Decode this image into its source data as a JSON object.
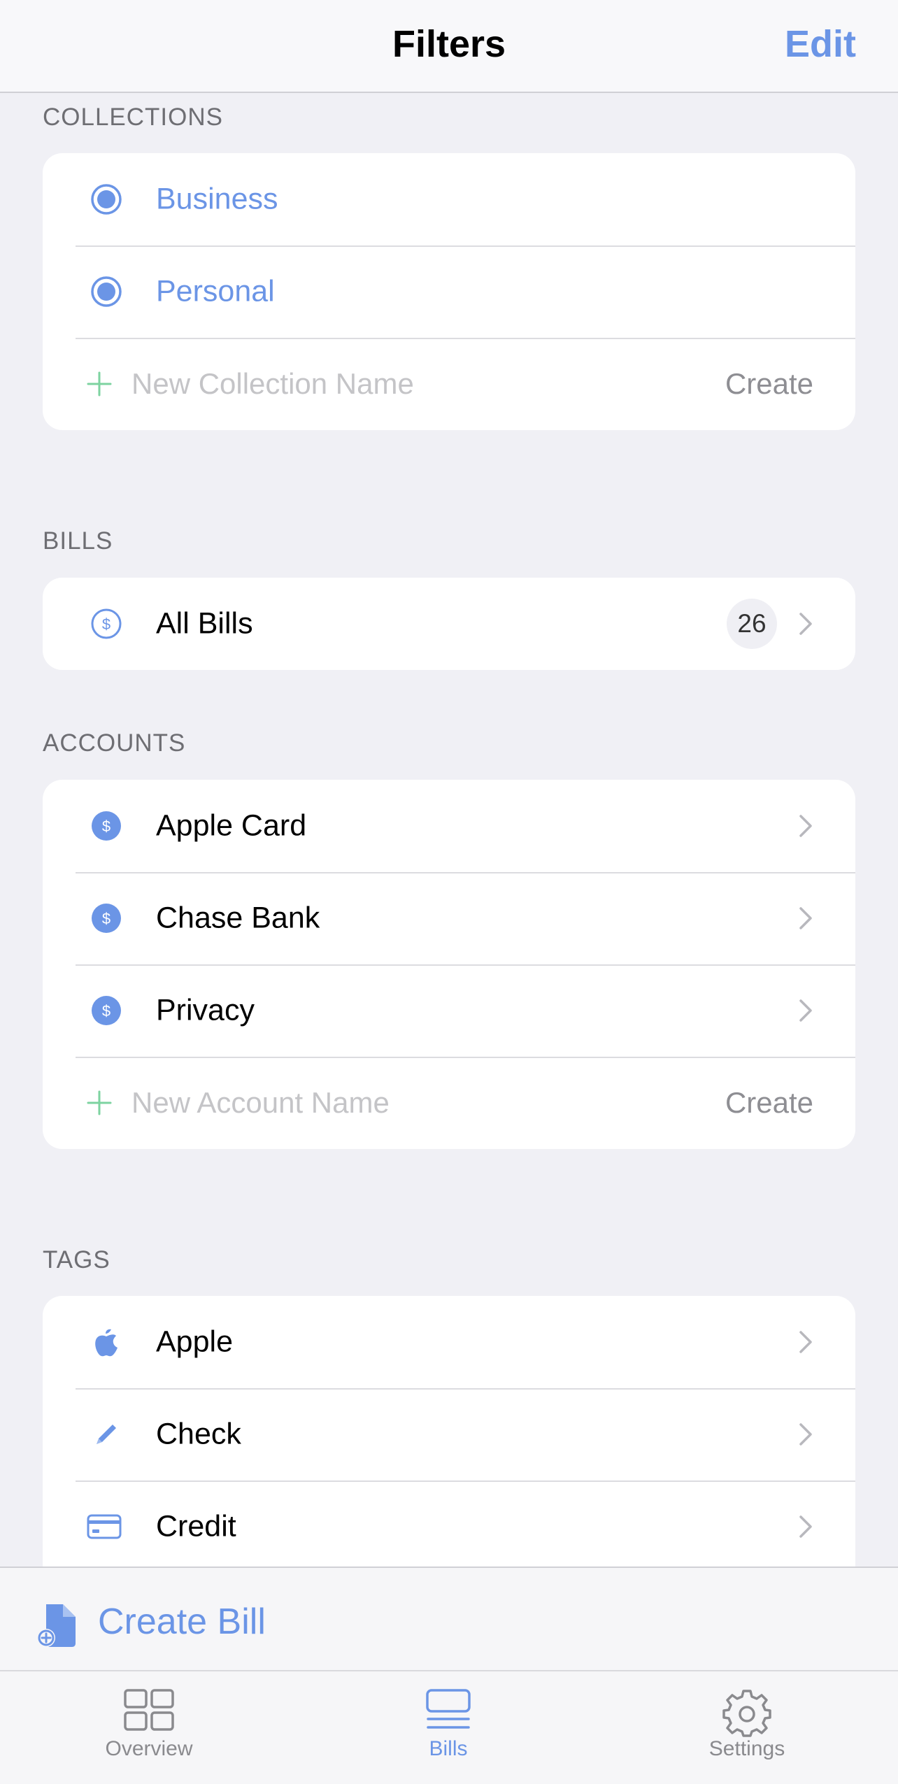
{
  "navbar": {
    "title": "Filters",
    "edit_label": "Edit"
  },
  "collections": {
    "header": "COLLECTIONS",
    "items": [
      {
        "label": "Business",
        "icon": "radio-selected-icon"
      },
      {
        "label": "Personal",
        "icon": "radio-selected-icon"
      }
    ],
    "new_placeholder": "New Collection Name",
    "create_label": "Create"
  },
  "bills": {
    "header": "BILLS",
    "items": [
      {
        "label": "All Bills",
        "count": "26",
        "icon": "dollar-circle-outline-icon"
      }
    ]
  },
  "accounts": {
    "header": "ACCOUNTS",
    "items": [
      {
        "label": "Apple Card",
        "icon": "dollar-circle-filled-icon"
      },
      {
        "label": "Chase Bank",
        "icon": "dollar-circle-filled-icon"
      },
      {
        "label": "Privacy",
        "icon": "dollar-circle-filled-icon"
      }
    ],
    "new_placeholder": "New Account Name",
    "create_label": "Create"
  },
  "tags": {
    "header": "TAGS",
    "items": [
      {
        "label": "Apple",
        "icon": "apple-icon"
      },
      {
        "label": "Check",
        "icon": "pencil-icon"
      },
      {
        "label": "Credit",
        "icon": "credit-card-icon"
      }
    ]
  },
  "toolbar": {
    "create_bill_label": "Create Bill",
    "icon": "document-add-icon"
  },
  "tabbar": {
    "tabs": [
      {
        "label": "Overview",
        "icon": "grid-icon",
        "active": false
      },
      {
        "label": "Bills",
        "icon": "list-icon",
        "active": true
      },
      {
        "label": "Settings",
        "icon": "gear-icon",
        "active": false
      }
    ]
  },
  "colors": {
    "accent": "#6b95e6",
    "plus_green": "#7dd3a0",
    "background": "#f0f0f5",
    "card": "#ffffff"
  }
}
